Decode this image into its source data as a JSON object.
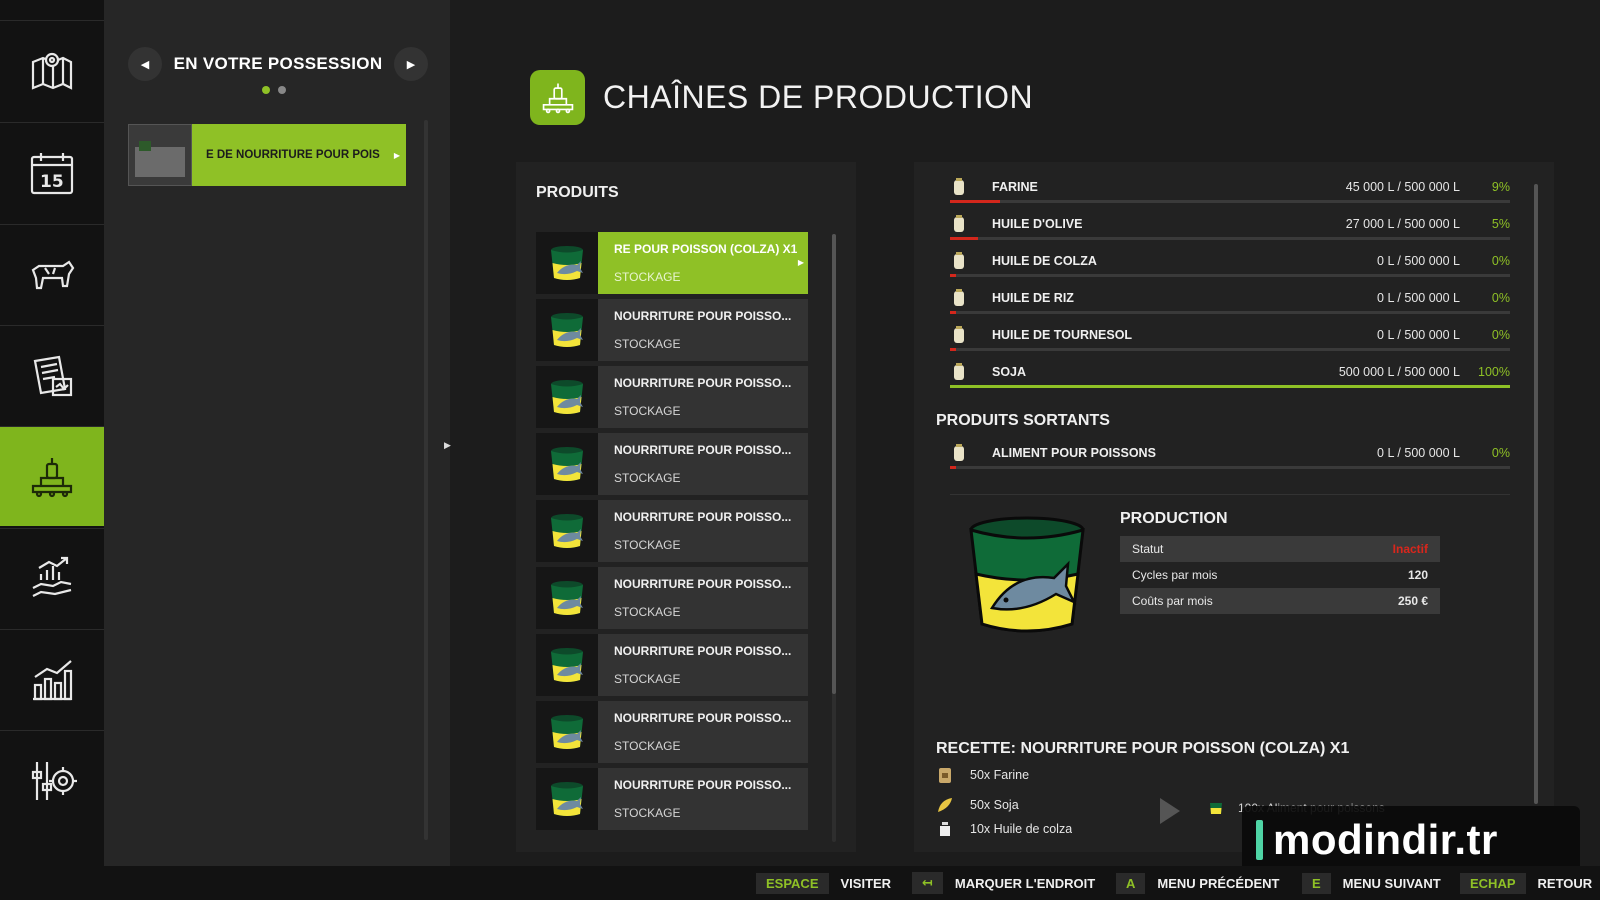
{
  "rail": {
    "items": [
      {
        "name": "map-icon"
      },
      {
        "name": "calendar-icon"
      },
      {
        "name": "animals-icon"
      },
      {
        "name": "contracts-icon"
      },
      {
        "name": "production-icon",
        "active": true
      },
      {
        "name": "finances-icon"
      },
      {
        "name": "statistics-icon"
      },
      {
        "name": "settings-icon"
      }
    ]
  },
  "possession": {
    "title": "EN VOTRE POSSESSION",
    "item_label": "E DE NOURRITURE POUR POIS"
  },
  "header": {
    "title": "CHAÎNES DE PRODUCTION"
  },
  "products": {
    "title": "PRODUITS",
    "items": [
      {
        "name": "RE POUR POISSON (COLZA) X1",
        "sub": "STOCKAGE"
      },
      {
        "name": "NOURRITURE POUR POISSO...",
        "sub": "STOCKAGE"
      },
      {
        "name": "NOURRITURE POUR POISSO...",
        "sub": "STOCKAGE"
      },
      {
        "name": "NOURRITURE POUR POISSO...",
        "sub": "STOCKAGE"
      },
      {
        "name": "NOURRITURE POUR POISSO...",
        "sub": "STOCKAGE"
      },
      {
        "name": "NOURRITURE POUR POISSO...",
        "sub": "STOCKAGE"
      },
      {
        "name": "NOURRITURE POUR POISSO...",
        "sub": "STOCKAGE"
      },
      {
        "name": "NOURRITURE POUR POISSO...",
        "sub": "STOCKAGE"
      },
      {
        "name": "NOURRITURE POUR POISSO...",
        "sub": "STOCKAGE"
      }
    ]
  },
  "inputs": [
    {
      "name": "FARINE",
      "amount": "45 000 L / 500 000 L",
      "pct": "9%",
      "fill": 0.09
    },
    {
      "name": "HUILE D'OLIVE",
      "amount": "27 000 L / 500 000 L",
      "pct": "5%",
      "fill": 0.05
    },
    {
      "name": "HUILE DE COLZA",
      "amount": "0 L / 500 000 L",
      "pct": "0%",
      "fill": 0
    },
    {
      "name": "HUILE DE RIZ",
      "amount": "0 L / 500 000 L",
      "pct": "0%",
      "fill": 0
    },
    {
      "name": "HUILE DE TOURNESOL",
      "amount": "0 L / 500 000 L",
      "pct": "0%",
      "fill": 0
    },
    {
      "name": "SOJA",
      "amount": "500 000 L / 500 000 L",
      "pct": "100%",
      "fill": 1
    }
  ],
  "outputs": {
    "title": "PRODUITS SORTANTS",
    "items": [
      {
        "name": "ALIMENT POUR POISSONS",
        "amount": "0 L / 500 000 L",
        "pct": "0%",
        "fill": 0
      }
    ]
  },
  "production": {
    "title": "PRODUCTION",
    "status_label": "Statut",
    "status_value": "Inactif",
    "cycles_label": "Cycles par mois",
    "cycles_value": "120",
    "costs_label": "Coûts par mois",
    "costs_value": "250 €"
  },
  "recipe": {
    "title": "RECETTE: NOURRITURE POUR POISSON (COLZA) X1",
    "ingredients": [
      "50x Farine",
      "50x Soja",
      "10x Huile de colza"
    ],
    "output": "100x Aliment pour poissons"
  },
  "watermark": "modindir.tr",
  "bottombar": {
    "space_key": "ESPACE",
    "visit": "VISITER",
    "mark_key": "↤",
    "mark": "MARQUER L'ENDROIT",
    "prev_key": "A",
    "prev": "MENU PRÉCÉDENT",
    "next_key": "E",
    "next": "MENU SUIVANT",
    "esc_key": "ECHAP",
    "back": "RETOUR"
  },
  "colors": {
    "accent": "#8fc126",
    "warning": "#d3271c"
  }
}
